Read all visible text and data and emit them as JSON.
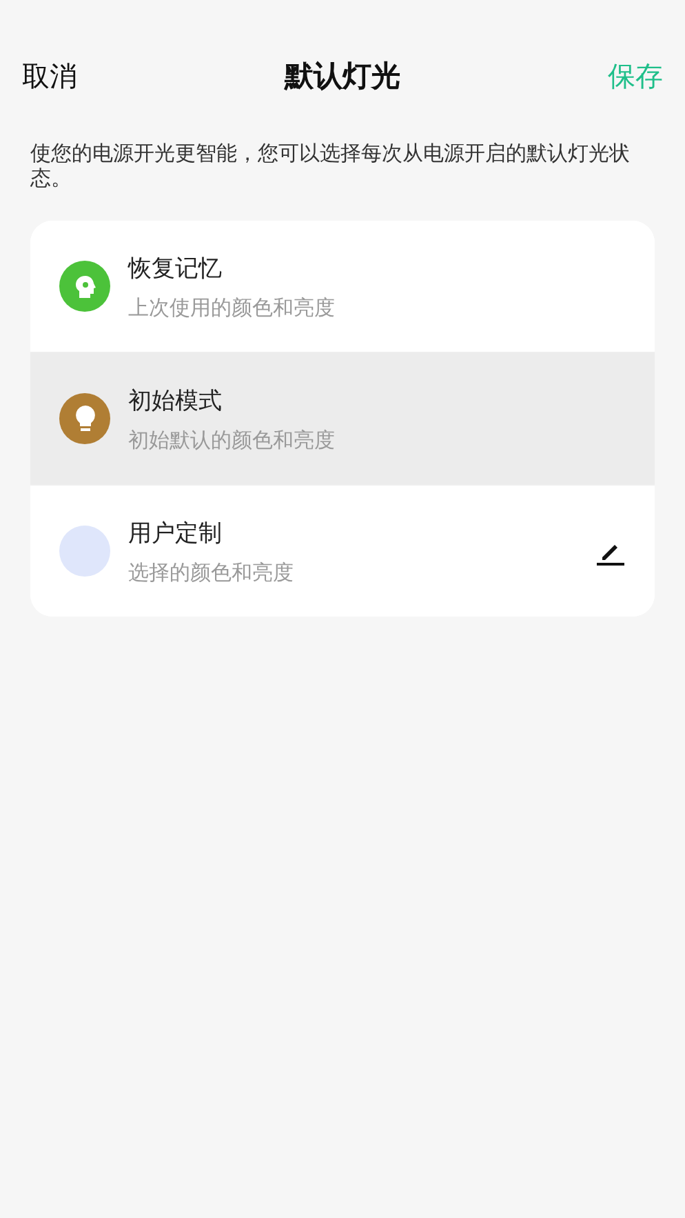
{
  "header": {
    "cancel": "取消",
    "title": "默认灯光",
    "save": "保存"
  },
  "description": "使您的电源开光更智能，您可以选择每次从电源开启的默认灯光状态。",
  "options": [
    {
      "kind": "memory",
      "title": "恢复记忆",
      "subtitle": "上次使用的颜色和亮度",
      "color": "#4cc23a",
      "selected": false
    },
    {
      "kind": "default",
      "title": "初始模式",
      "subtitle": "初始默认的颜色和亮度",
      "color": "#b07e34",
      "selected": true
    },
    {
      "kind": "custom",
      "title": "用户定制",
      "subtitle": "选择的颜色和亮度",
      "color": "#dfe6fb",
      "selected": false
    }
  ]
}
